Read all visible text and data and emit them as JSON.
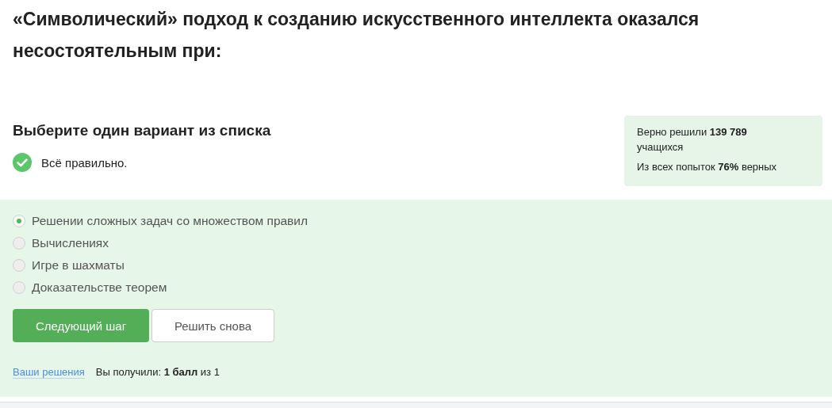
{
  "question": {
    "title": "«Символический» подход к созданию искусственного интеллекта оказался несостоятельным при:"
  },
  "instruction": "Выберите один вариант из списка",
  "feedback": {
    "kind": "correct",
    "text": "Всё правильно."
  },
  "stats": [
    "Верно решили **139 789** учащихся",
    "Из всех попыток **76%** верных"
  ],
  "options": [
    {
      "label": "Решении сложных задач со множеством правил",
      "selected": true
    },
    {
      "label": "Вычислениях",
      "selected": false
    },
    {
      "label": "Игре в шахматы",
      "selected": false
    },
    {
      "label": "Доказательстве теорем",
      "selected": false
    }
  ],
  "buttons": [
    {
      "label": "Следующий шаг",
      "kind": "primary"
    },
    {
      "label": "Решить снова",
      "kind": "secondary"
    }
  ],
  "footer": {
    "link": "Ваши решения",
    "score": "Вы получили: **1 балл** из 1"
  }
}
